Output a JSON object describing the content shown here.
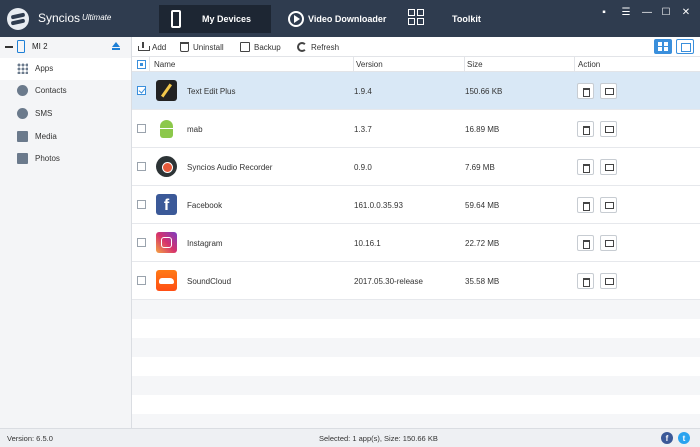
{
  "window": {
    "app_name": "Syncios",
    "edition": "Ultimate",
    "tabs": [
      {
        "label": "My Devices"
      },
      {
        "label": "Video Downloader"
      },
      {
        "label": "Toolkit"
      }
    ],
    "controls": {
      "menu": "▪",
      "minimize": "—",
      "maximize": "☐",
      "close": "✕"
    }
  },
  "sidebar": {
    "device": {
      "name": "MI 2"
    },
    "items": [
      {
        "label": "Apps",
        "icon": "apps-icon",
        "active": true
      },
      {
        "label": "Contacts",
        "icon": "contacts-icon"
      },
      {
        "label": "SMS",
        "icon": "sms-icon"
      },
      {
        "label": "Media",
        "icon": "media-icon"
      },
      {
        "label": "Photos",
        "icon": "photos-icon"
      }
    ]
  },
  "toolbar": {
    "add_label": "Add",
    "uninstall_label": "Uninstall",
    "backup_label": "Backup",
    "refresh_label": "Refresh"
  },
  "table": {
    "headers": {
      "name": "Name",
      "version": "Version",
      "size": "Size",
      "action": "Action"
    },
    "rows": [
      {
        "name": "Text Edit Plus",
        "version": "1.9.4",
        "size": "150.66 KB",
        "checked": true,
        "icon": "text-edit-plus-icon"
      },
      {
        "name": "mab",
        "version": "1.3.7",
        "size": "16.89 MB",
        "checked": false,
        "icon": "android-icon"
      },
      {
        "name": "Syncios Audio Recorder",
        "version": "0.9.0",
        "size": "7.69 MB",
        "checked": false,
        "icon": "audio-recorder-icon"
      },
      {
        "name": "Facebook",
        "version": "161.0.0.35.93",
        "size": "59.64 MB",
        "checked": false,
        "icon": "facebook-icon"
      },
      {
        "name": "Instagram",
        "version": "10.16.1",
        "size": "22.72 MB",
        "checked": false,
        "icon": "instagram-icon"
      },
      {
        "name": "SoundCloud",
        "version": "2017.05.30-release",
        "size": "35.58 MB",
        "checked": false,
        "icon": "soundcloud-icon"
      }
    ]
  },
  "status": {
    "version": "Version: 6.5.0",
    "selection": "Selected: 1 app(s), Size: 150.66 KB"
  },
  "colors": {
    "titlebar": "#2f3c4f",
    "accent": "#3a8fdc",
    "selected_row": "#d9e8f6"
  }
}
